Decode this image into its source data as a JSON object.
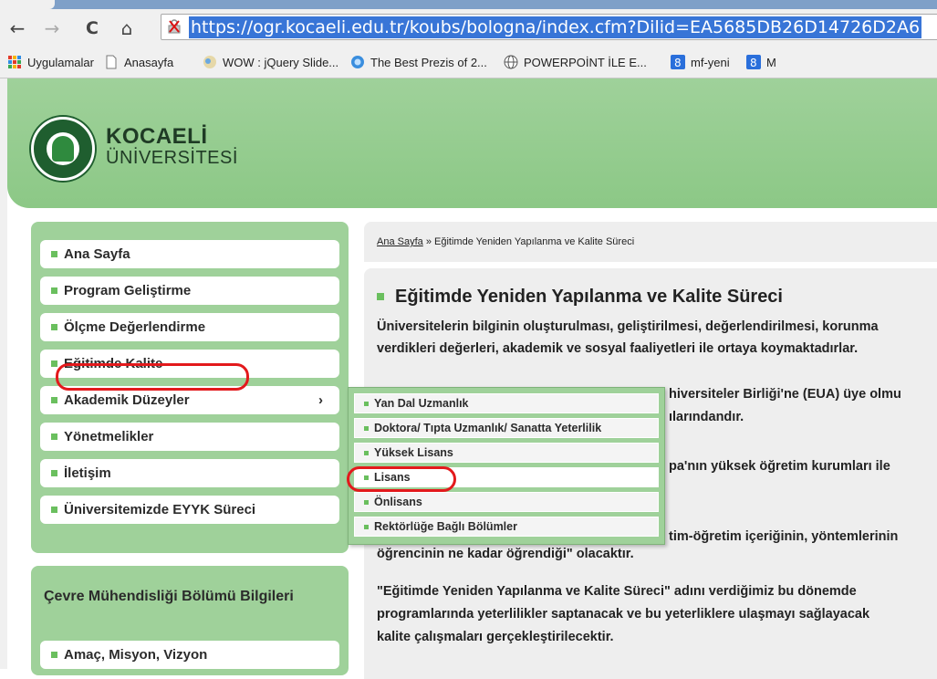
{
  "browser": {
    "url": "https://ogr.kocaeli.edu.tr/koubs/bologna/index.cfm?Dilid=EA5685DB26D14726D2A6",
    "nav": {
      "back": "←",
      "forward": "→",
      "reload": "C",
      "home": "⌂"
    },
    "bookmarks": [
      {
        "label": "Uygulamalar",
        "icon": "apps-grid-icon"
      },
      {
        "label": "Anasayfa",
        "icon": "page-icon"
      },
      {
        "label": "WOW : jQuery Slide...",
        "icon": "wow-icon"
      },
      {
        "label": "The Best Prezis of 2...",
        "icon": "prezi-icon"
      },
      {
        "label": "POWERPOİNT İLE E...",
        "icon": "globe-icon"
      },
      {
        "label": "mf-yeni",
        "icon": "google-sites-icon"
      },
      {
        "label": "M",
        "icon": "google-sites-icon"
      }
    ]
  },
  "header": {
    "title": "KOCAELİ",
    "subtitle": "ÜNİVERSİTESİ"
  },
  "sidebar": {
    "items": [
      {
        "label": "Ana Sayfa"
      },
      {
        "label": "Program Geliştirme"
      },
      {
        "label": "Ölçme Değerlendirme"
      },
      {
        "label": "Eğitimde Kalite"
      },
      {
        "label": "Akademik Düzeyler",
        "chevron": "›"
      },
      {
        "label": "Yönetmelikler"
      },
      {
        "label": "İletişim"
      },
      {
        "label": "Üniversitemizde EYYK Süreci"
      }
    ],
    "section2": {
      "title": "Çevre Mühendisliği Bölümü Bilgileri",
      "items": [
        {
          "label": "Amaç, Misyon, Vizyon"
        }
      ]
    }
  },
  "submenu": {
    "items": [
      {
        "label": "Yan Dal Uzmanlık"
      },
      {
        "label": "Doktora/ Tıpta Uzmanlık/ Sanatta Yeterlilik"
      },
      {
        "label": "Yüksek Lisans"
      },
      {
        "label": "Lisans"
      },
      {
        "label": "Önlisans"
      },
      {
        "label": "Rektörlüğe Bağlı Bölümler"
      }
    ]
  },
  "breadcrumb": {
    "home": "Ana Sayfa",
    "separator": "»",
    "current": "Eğitimde Yeniden Yapılanma ve Kalite Süreci"
  },
  "content": {
    "title": "Eğitimde Yeniden Yapılanma ve Kalite Süreci",
    "lines": [
      "Üniversitelerin bilginin oluşturulması, geliştirilmesi, değerlendirilmesi, korunma",
      "verdikleri değerleri, akademik ve sosyal faaliyetleri ile ortaya koymaktadırlar.",
      "hiversiteler Birliği'ne (EUA) üye olmu",
      "ılarındandır.",
      "pa'nın yüksek öğretim kurumları ile",
      "tim-öğretim içeriğinin, yöntemlerinin",
      "öğrencinin ne kadar öğrendiği\" olacaktır.",
      "\"Eğitimde Yeniden Yapılanma ve Kalite Süreci\" adını verdiğimiz bu dönemde",
      "programlarında yeterlilikler saptanacak ve bu yeterliklere ulaşmayı sağlayacak",
      "kalite çalışmaları gerçekleştirilecektir."
    ]
  },
  "colors": {
    "green_panel": "#9fd19a",
    "bullet_green": "#6abf5e",
    "annotation_red": "#e3191c",
    "url_highlight": "#3875d7"
  }
}
